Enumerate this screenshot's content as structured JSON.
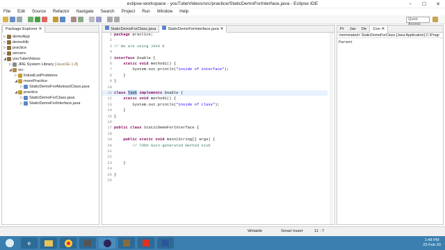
{
  "window": {
    "title": "eclipse-workspace - youTubeVideos/src/practice/StaticDemoForInterface.java - Eclipse IDE",
    "controls": [
      "−",
      "☐",
      "✕"
    ]
  },
  "menu": [
    "File",
    "Edit",
    "Source",
    "Refactor",
    "Navigate",
    "Search",
    "Project",
    "Run",
    "Window",
    "Help"
  ],
  "quick_access": {
    "placeholder": "Quick Access"
  },
  "package_explorer": {
    "tab_label": "Package Explorer",
    "items": [
      {
        "label": "demoApp"
      },
      {
        "label": "demoHib"
      },
      {
        "label": "practice"
      },
      {
        "label": "servers"
      },
      {
        "label": "youTubeVideos"
      },
      {
        "label": "JRE System Library",
        "suffix": "[JavaSE-1.8]"
      },
      {
        "label": "src"
      },
      {
        "label": "linkedListProblems"
      },
      {
        "label": "morePractice"
      },
      {
        "label": "StaticDemoForAbstractClass.java"
      },
      {
        "label": "practice"
      },
      {
        "label": "StaticDemoForClass.java"
      },
      {
        "label": "StaticDemoForInterface.java"
      }
    ]
  },
  "editor": {
    "tabs": [
      "StaticDemoForClass.java",
      "StaticDemoForInterface.java"
    ],
    "active_tab": 1,
    "lines": [
      {
        "n": "1",
        "parts": [
          [
            "kw",
            "package"
          ],
          [
            "t",
            " practice;"
          ]
        ]
      },
      {
        "n": "2",
        "parts": []
      },
      {
        "n": "3",
        "parts": [
          [
            "cm",
            "// We are using JAVA 8"
          ]
        ]
      },
      {
        "n": "4",
        "parts": []
      },
      {
        "n": "5",
        "parts": [
          [
            "kw",
            "interface"
          ],
          [
            "t",
            " Doable {"
          ]
        ]
      },
      {
        "n": "6",
        "parts": [
          [
            "t",
            "    "
          ],
          [
            "kw",
            "static void"
          ],
          [
            "t",
            " method1() {"
          ]
        ]
      },
      {
        "n": "7",
        "parts": [
          [
            "t",
            "        System.out.println("
          ],
          [
            "st",
            "\"inside of interface\""
          ],
          [
            "t",
            ");"
          ]
        ]
      },
      {
        "n": "8",
        "parts": [
          [
            "t",
            "    }"
          ]
        ]
      },
      {
        "n": "9",
        "parts": [
          [
            "t",
            "}"
          ]
        ]
      },
      {
        "n": "10",
        "parts": []
      },
      {
        "n": "11",
        "parts": [
          [
            "kw",
            "class"
          ],
          [
            "t",
            " "
          ],
          [
            "sel",
            "Task"
          ],
          [
            "t",
            " "
          ],
          [
            "kw",
            "implements"
          ],
          [
            "t",
            " Doable {"
          ]
        ],
        "hl": true
      },
      {
        "n": "12",
        "parts": [
          [
            "t",
            "    "
          ],
          [
            "kw",
            "static void"
          ],
          [
            "t",
            " method1() {"
          ]
        ]
      },
      {
        "n": "13",
        "parts": [
          [
            "t",
            "        System.out.println("
          ],
          [
            "st",
            "\"inside of class\""
          ],
          [
            "t",
            ");"
          ]
        ]
      },
      {
        "n": "14",
        "parts": [
          [
            "t",
            "    }"
          ]
        ]
      },
      {
        "n": "15",
        "parts": [
          [
            "t",
            "}"
          ]
        ]
      },
      {
        "n": "16",
        "parts": []
      },
      {
        "n": "17",
        "parts": [
          [
            "kw",
            "public class"
          ],
          [
            "t",
            " StaticDemoForInterface {"
          ]
        ]
      },
      {
        "n": "18",
        "parts": []
      },
      {
        "n": "19",
        "parts": [
          [
            "t",
            "    "
          ],
          [
            "kw",
            "public static void"
          ],
          [
            "t",
            " main(String[] args) {"
          ]
        ]
      },
      {
        "n": "20",
        "parts": [
          [
            "t",
            "        "
          ],
          [
            "cm",
            "// TODO Auto-generated method stub"
          ]
        ]
      },
      {
        "n": "21",
        "parts": []
      },
      {
        "n": "22",
        "parts": []
      },
      {
        "n": "23",
        "parts": [
          [
            "t",
            "    }"
          ]
        ]
      },
      {
        "n": "24",
        "parts": []
      },
      {
        "n": "25",
        "parts": [
          [
            "t",
            "}"
          ]
        ]
      },
      {
        "n": "26",
        "parts": []
      }
    ]
  },
  "console": {
    "tabs": [
      "Pr",
      "Jav",
      "De",
      "Con"
    ],
    "header": "<terminated> StaticDemoForClass [Java Application] C:\\Progr",
    "output": "Parent"
  },
  "status": {
    "mode": "Writable",
    "insert": "Smart Insert",
    "position": "11 : 7"
  },
  "taskbar": {
    "time": "1:48 PM",
    "date": "23-Feb-20",
    "apps": [
      "start-button",
      "ie-icon",
      "explorer-icon",
      "media-icon",
      "chrome-icon",
      "eclipse-icon",
      "app-icon",
      "pdf-icon",
      "word-icon"
    ]
  },
  "colors": {
    "taskbar": "#3a7fb0",
    "keyword": "#7f0055",
    "comment": "#3f7f5f",
    "string": "#2a00ff"
  }
}
